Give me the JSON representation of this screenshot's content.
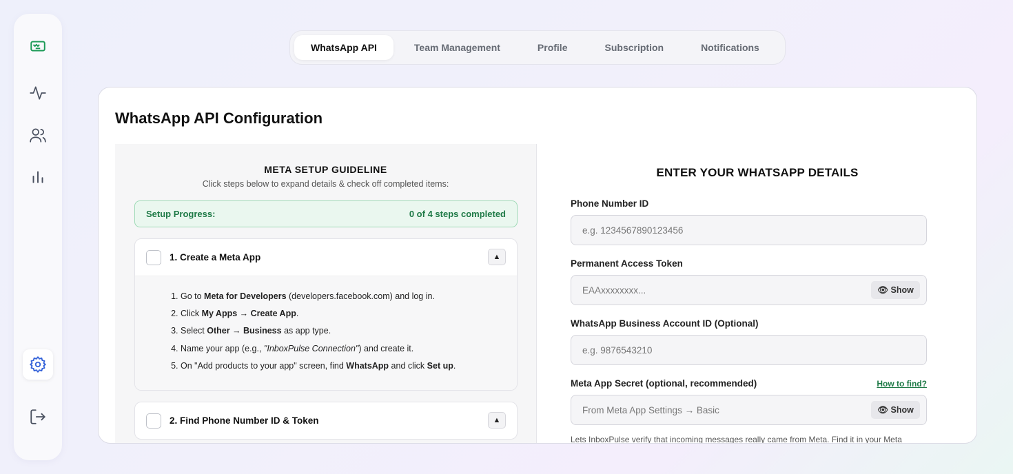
{
  "sidebar": {
    "items": [
      {
        "icon": "whatsapp-logo-icon"
      },
      {
        "icon": "activity-icon"
      },
      {
        "icon": "users-icon"
      },
      {
        "icon": "bar-chart-icon"
      },
      {
        "icon": "gear-icon"
      },
      {
        "icon": "logout-icon"
      }
    ],
    "active_index": 4
  },
  "tabs": [
    "WhatsApp API",
    "Team Management",
    "Profile",
    "Subscription",
    "Notifications"
  ],
  "active_tab": "WhatsApp API",
  "card": {
    "title": "WhatsApp API Configuration"
  },
  "guide": {
    "title": "META SETUP GUIDELINE",
    "subtitle": "Click steps below to expand details & check off completed items:",
    "progress_label": "Setup Progress:",
    "progress_status": "0 of 4 steps completed",
    "toggle_glyph": "▲",
    "steps": [
      {
        "title": "1. Create a Meta App",
        "lines": [
          {
            "a": "Go to ",
            "b": "Meta for Developers",
            "c": " (developers.facebook.com) and log in."
          },
          {
            "a": "Click ",
            "b": "My Apps → Create App",
            "c": "."
          },
          {
            "a": "Select ",
            "b": "Other → Business",
            "c": " as app type."
          },
          {
            "a": "Name your app (e.g., ",
            "i": "\"InboxPulse Connection\"",
            "c": ") and create it."
          },
          {
            "a": "On \"Add products to your app\" screen, find ",
            "b": "WhatsApp",
            "c": " and click ",
            "b2": "Set up",
            "d": "."
          }
        ]
      },
      {
        "title": "2. Find Phone Number ID & Token"
      }
    ]
  },
  "details": {
    "title": "ENTER YOUR WHATSAPP DETAILS",
    "phone_label": "Phone Number ID",
    "phone_placeholder": "e.g. 1234567890123456",
    "token_label": "Permanent Access Token",
    "token_placeholder": "EAAxxxxxxxx...",
    "show_label": "👁 Show",
    "waba_label": "WhatsApp Business Account ID (Optional)",
    "waba_placeholder": "e.g. 9876543210",
    "secret_label": "Meta App Secret (optional, recommended)",
    "secret_link": "How to find?",
    "secret_placeholder": "From Meta App Settings → Basic",
    "help_text": "Lets InboxPulse verify that incoming messages really came from Meta. Find it in your Meta"
  },
  "colors": {
    "accent_green": "#1f7a47",
    "progress_bg": "#eaf7ef",
    "sidebar_icon": "#4a5160",
    "active_icon": "#3563d9"
  }
}
